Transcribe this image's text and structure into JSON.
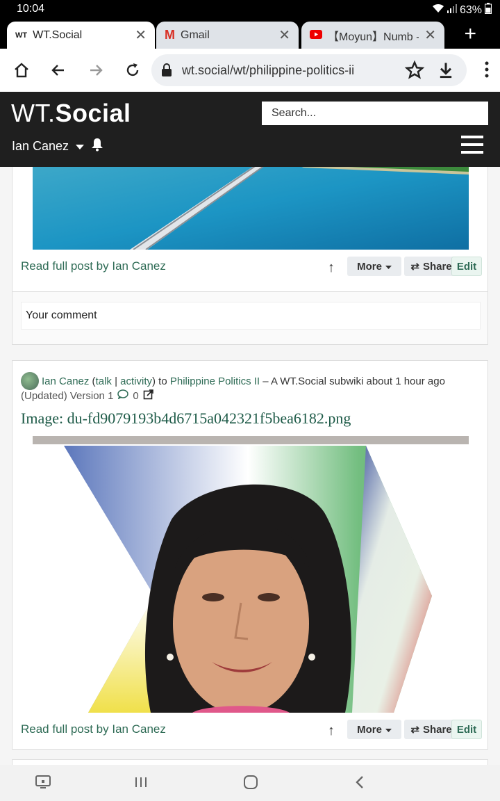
{
  "status": {
    "time": "10:04",
    "battery": "63%"
  },
  "browser": {
    "tabs": [
      {
        "favicon": "WT",
        "label": "WT.Social",
        "active": true
      },
      {
        "favicon": "M",
        "label": "Gmail",
        "active": false
      },
      {
        "favicon": "youtube-icon",
        "label": "【Moyun】Numb - L",
        "active": false
      }
    ],
    "url": "wt.social/wt/philippine-politics-ii"
  },
  "site": {
    "logo_prefix": "WT.",
    "logo_main": "Social",
    "search_placeholder": "Search...",
    "user_name": "Ian Canez"
  },
  "post1": {
    "read_link": "Read full post by Ian Canez",
    "more_label": "More",
    "share_label": "Share",
    "edit_label": "Edit",
    "comment_placeholder": "Your comment"
  },
  "post2": {
    "author": "Ian Canez",
    "talk": "talk",
    "sep": "|",
    "activity": "activity",
    "to": "to",
    "subwiki": "Philippine Politics II",
    "dash": "– A WT.Social subwiki",
    "time": "about 1 hour ago",
    "version": "(Updated) Version 1",
    "comment_count": "0",
    "image_title": "Image: du-fd9079193b4d6715a042321f5bea6182.png",
    "read_link": "Read full post by Ian Canez",
    "more_label": "More",
    "share_label": "Share",
    "edit_label": "Edit"
  }
}
